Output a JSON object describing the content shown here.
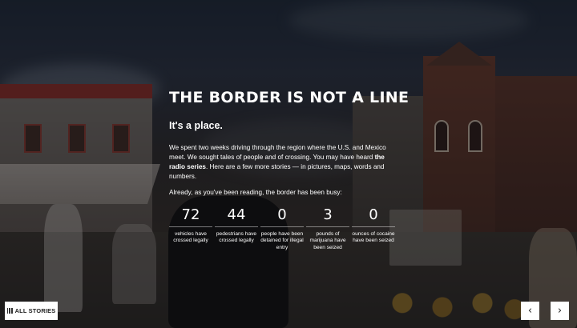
{
  "article": {
    "headline": "THE BORDER IS NOT A LINE",
    "subhead": "It's a place.",
    "intro_before": "We spent two weeks driving through the region where the U.S. and Mexico meet. We sought tales of people and of crossing. You may have heard ",
    "intro_bold": "the radio series",
    "intro_after": ". Here are a few more stories — in pictures, maps, words and numbers.",
    "busy_text": "Already, as you've been reading, the border has been busy:"
  },
  "stats": [
    {
      "value": "72",
      "label": "vehicles have crossed legally"
    },
    {
      "value": "44",
      "label": "pedestrians have crossed legally"
    },
    {
      "value": "0",
      "label": "people have been detained for illegal entry"
    },
    {
      "value": "3",
      "label": "pounds of marijuana have been seized"
    },
    {
      "value": "0",
      "label": "ounces of cocaine have been seized"
    }
  ],
  "controls": {
    "all_stories_label": "ALL STORIES",
    "prev_glyph": "‹",
    "next_glyph": "›"
  },
  "icons": {
    "all_stories": "grid-icon",
    "prev": "chevron-left-icon",
    "next": "chevron-right-icon"
  }
}
